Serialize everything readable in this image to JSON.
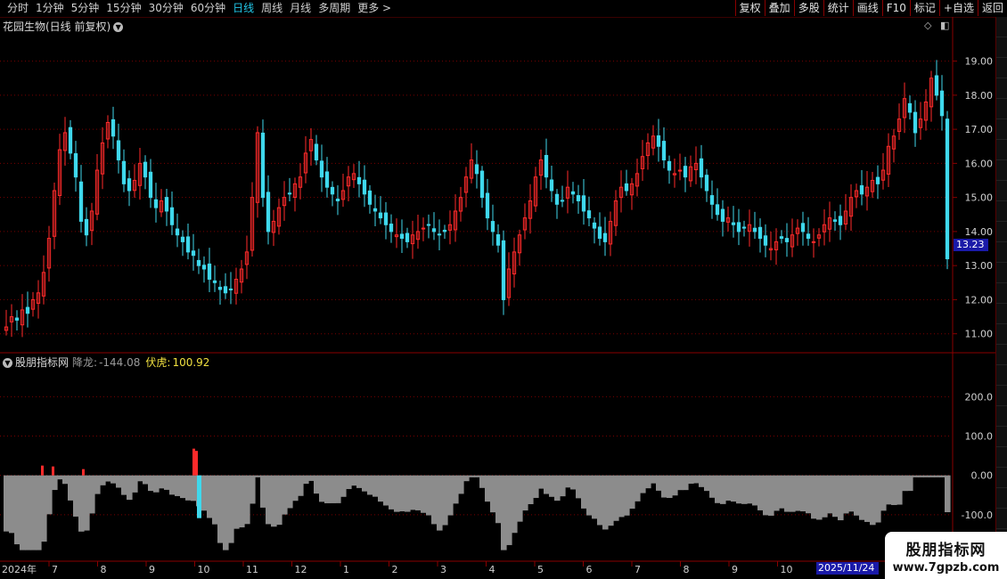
{
  "toolbar": {
    "periods": [
      "分时",
      "1分钟",
      "5分钟",
      "15分钟",
      "30分钟",
      "60分钟",
      "日线",
      "周线",
      "月线",
      "多周期",
      "更多 >"
    ],
    "active_period": "日线",
    "actions": [
      "复权",
      "叠加",
      "多股",
      "统计",
      "画线",
      "F10",
      "标记",
      "+自选",
      "返回"
    ]
  },
  "main": {
    "title": "花园生物(日线 前复权)",
    "price_ticks": [
      "19.00",
      "18.00",
      "17.00",
      "16.00",
      "15.00",
      "14.00",
      "13.00",
      "12.00",
      "11.00"
    ],
    "current_price": "13.23"
  },
  "indicator": {
    "name": "股朋指标网",
    "line1_label": "降龙:",
    "line1_value": "-144.08",
    "line2_label": "伏虎:",
    "line2_value": "100.92",
    "ticks": [
      "200.0",
      "100.0",
      "0.00",
      "-100.0"
    ]
  },
  "time_axis": {
    "labels": [
      "2024年",
      "7",
      "8",
      "9",
      "10",
      "11",
      "12",
      "1",
      "2",
      "3",
      "4",
      "5",
      "6",
      "7",
      "8",
      "9",
      "10",
      "11"
    ],
    "cursor_date": "2025/11/24"
  },
  "watermark": {
    "line1": "股朋指标网",
    "line2": "www.7gpzb.com"
  },
  "colors": {
    "up": "#ff2a2a",
    "down": "#3fd8ec",
    "grid": "#7a0000",
    "neutral": "#8c8c8c"
  },
  "chart_data": {
    "type": "candlestick",
    "title": "花园生物(日线 前复权)",
    "ylim": [
      10.6,
      19.8
    ],
    "closes": [
      11.2,
      11.5,
      11.4,
      11.7,
      11.6,
      12.0,
      12.2,
      12.8,
      13.8,
      15.2,
      16.4,
      16.9,
      16.3,
      15.6,
      14.3,
      13.9,
      14.6,
      15.8,
      16.6,
      17.2,
      16.8,
      16.1,
      15.4,
      15.2,
      15.5,
      16.0,
      15.6,
      15.0,
      14.7,
      14.9,
      14.6,
      14.2,
      13.9,
      13.7,
      13.4,
      13.3,
      13.0,
      12.9,
      12.6,
      12.5,
      12.3,
      12.2,
      12.3,
      12.6,
      12.9,
      13.4,
      15.0,
      16.9,
      15.0,
      14.0,
      14.3,
      14.7,
      15.0,
      15.1,
      15.4,
      15.6,
      16.3,
      16.7,
      16.1,
      15.6,
      15.3,
      15.1,
      14.9,
      15.2,
      15.6,
      15.7,
      15.4,
      15.1,
      14.8,
      14.6,
      14.4,
      14.2,
      14.0,
      13.9,
      13.8,
      13.7,
      13.9,
      14.0,
      14.1,
      14.2,
      14.0,
      13.9,
      14.0,
      14.2,
      14.6,
      15.0,
      15.6,
      16.1,
      15.7,
      15.0,
      14.4,
      14.0,
      13.6,
      12.0,
      12.9,
      13.4,
      13.9,
      14.4,
      14.9,
      15.6,
      16.1,
      15.6,
      15.2,
      14.8,
      14.9,
      15.3,
      15.1,
      14.9,
      14.6,
      14.4,
      14.1,
      13.8,
      13.7,
      14.3,
      14.9,
      15.3,
      15.2,
      15.4,
      15.7,
      16.2,
      16.6,
      16.8,
      16.5,
      16.1,
      15.8,
      15.7,
      15.8,
      15.6,
      15.9,
      16.0,
      15.6,
      15.2,
      14.8,
      14.5,
      14.3,
      14.4,
      14.2,
      14.0,
      14.1,
      14.2,
      14.0,
      13.8,
      13.6,
      13.5,
      13.7,
      13.8,
      13.7,
      13.9,
      14.1,
      14.0,
      13.8,
      13.7,
      13.9,
      14.2,
      14.4,
      14.3,
      14.2,
      14.6,
      15.0,
      15.2,
      15.1,
      15.3,
      15.5,
      15.4,
      15.8,
      16.5,
      16.8,
      17.3,
      17.9,
      17.5,
      16.9,
      17.3,
      17.8,
      18.5,
      18.0,
      17.4,
      13.2
    ]
  }
}
